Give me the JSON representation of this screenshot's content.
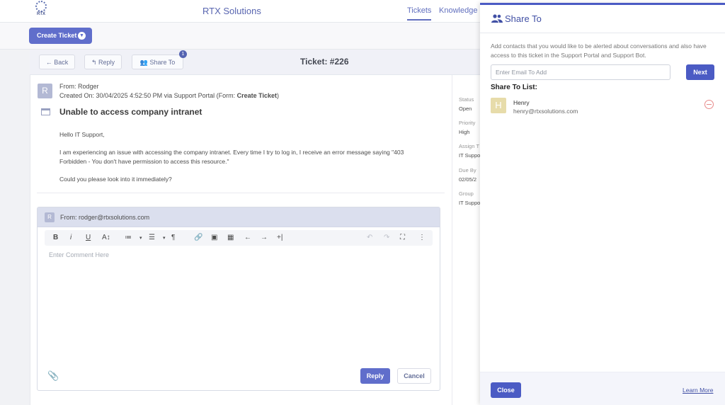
{
  "app": {
    "title": "RTX Solutions",
    "logo_text": "RTX",
    "nav_tabs": [
      "Tickets",
      "Knowledge B"
    ]
  },
  "toolbar": {
    "create_ticket": "Create Ticket"
  },
  "ticket": {
    "back_label": "Back",
    "reply_label": "Reply",
    "share_label": "Share To",
    "share_badge": "1",
    "number": "Ticket: #226",
    "avatar_letter": "R",
    "from": "From: Rodger",
    "created_prefix": "Created On: 30/04/2025 4:52:50 PM via Support Portal (Form: ",
    "created_form": "Create Ticket",
    "created_suffix": ")",
    "subject": "Unable to access company intranet",
    "body": [
      "Hello IT Support,",
      "I am experiencing an issue with accessing the company intranet. Every time I try to log in, I receive an error message saying \"403 Forbidden - You don't have permission to access this resource.\"",
      "Could you please look into it immediately?"
    ]
  },
  "reply_box": {
    "avatar_letter": "R",
    "from": "From: rodger@rtxsolutions.com",
    "placeholder": "Enter Comment Here",
    "reply_button": "Reply",
    "cancel_button": "Cancel",
    "tools": [
      "B",
      "i",
      "U",
      "A↕",
      "≔",
      "▾",
      "☰",
      "▾",
      "¶",
      "🔗",
      "▣",
      "▦",
      "←",
      "→",
      "+|",
      "↶",
      "↷",
      "⛶",
      "⋮"
    ]
  },
  "side_info": [
    {
      "label": "Status",
      "value": "Open"
    },
    {
      "label": "Priority",
      "value": "High"
    },
    {
      "label": "Assign T",
      "value": "IT Suppo"
    },
    {
      "label": "Due By",
      "value": "02/05/2"
    },
    {
      "label": "Group",
      "value": "IT Suppo"
    }
  ],
  "drawer": {
    "title": "Share To",
    "description": "Add contacts that you would like to be alerted about conversations and also have access to this ticket in the Support Portal and Support Bot.",
    "email_placeholder": "Enter Email To Add",
    "next_button": "Next",
    "list_title": "Share To List:",
    "contacts": [
      {
        "initial": "H",
        "name": "Henry",
        "email": "henry@rtxsolutions.com"
      }
    ],
    "close_button": "Close",
    "learn_more": "Learn More"
  },
  "colors": {
    "accent": "#4b5bc4",
    "title_blue": "#4150a5",
    "remove_red": "#e88a8a"
  }
}
